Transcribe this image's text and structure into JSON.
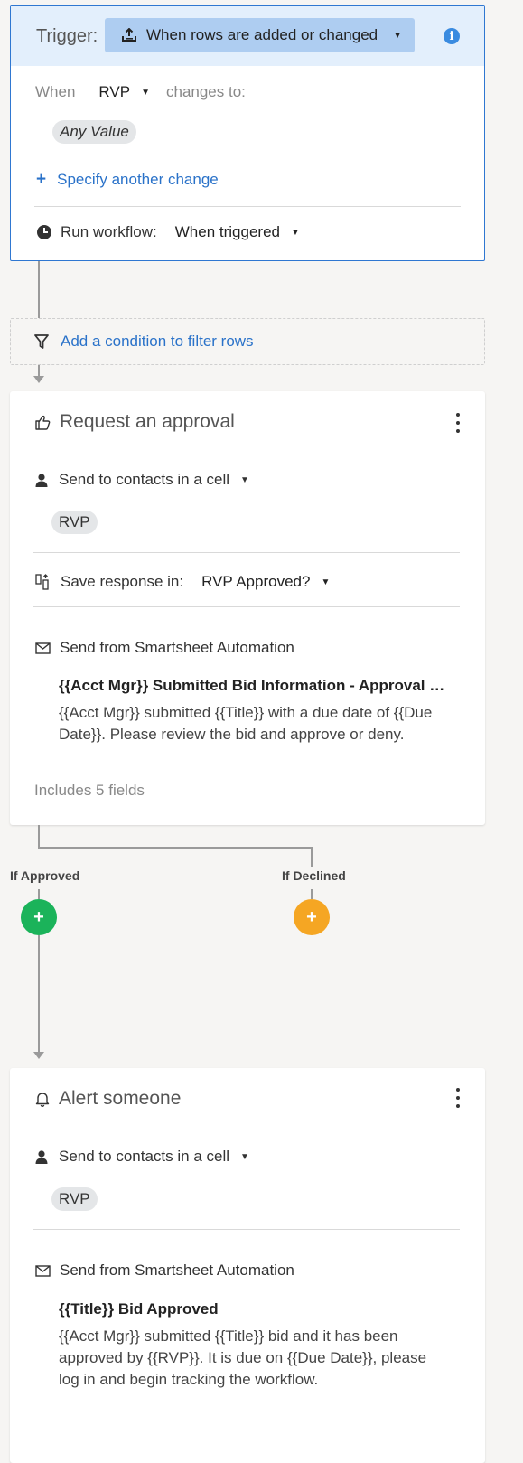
{
  "trigger": {
    "label": "Trigger:",
    "event": "When rows are added or changed",
    "when_label": "When",
    "column": "RVP",
    "changes_to": "changes to:",
    "value_pill": "Any Value",
    "specify_another": "Specify another change",
    "run_workflow_label": "Run workflow:",
    "run_workflow_value": "When triggered"
  },
  "condition": {
    "label": "Add a condition to filter rows"
  },
  "approval": {
    "title": "Request an approval",
    "send_to": "Send to contacts in a cell",
    "recipient_pill": "RVP",
    "save_response_label": "Save response in:",
    "save_response_value": "RVP Approved?",
    "send_from": "Send from Smartsheet Automation",
    "subject": "{{Acct Mgr}} Submitted Bid Information - Approval Requested",
    "message": "{{Acct Mgr}} submitted {{Title}} with a due date of {{Due Date}}. Please review the bid and approve or deny.",
    "includes": "Includes 5 fields"
  },
  "branches": {
    "approved_label": "If Approved",
    "declined_label": "If Declined",
    "approved_color": "#1bb35a",
    "declined_color": "#f5a623"
  },
  "alert": {
    "title": "Alert someone",
    "send_to": "Send to contacts in a cell",
    "recipient_pill": "RVP",
    "send_from": "Send from Smartsheet Automation",
    "subject": "{{Title}} Bid Approved",
    "message": "{{Acct Mgr}} submitted {{Title}} bid and it has been approved by {{RVP}}. It is due on {{Due Date}}, please log in and begin tracking the workflow."
  },
  "colors": {
    "accent": "#2a72c9",
    "trigger_bg": "#e3effc",
    "trigger_select_bg": "#aecdf1"
  }
}
